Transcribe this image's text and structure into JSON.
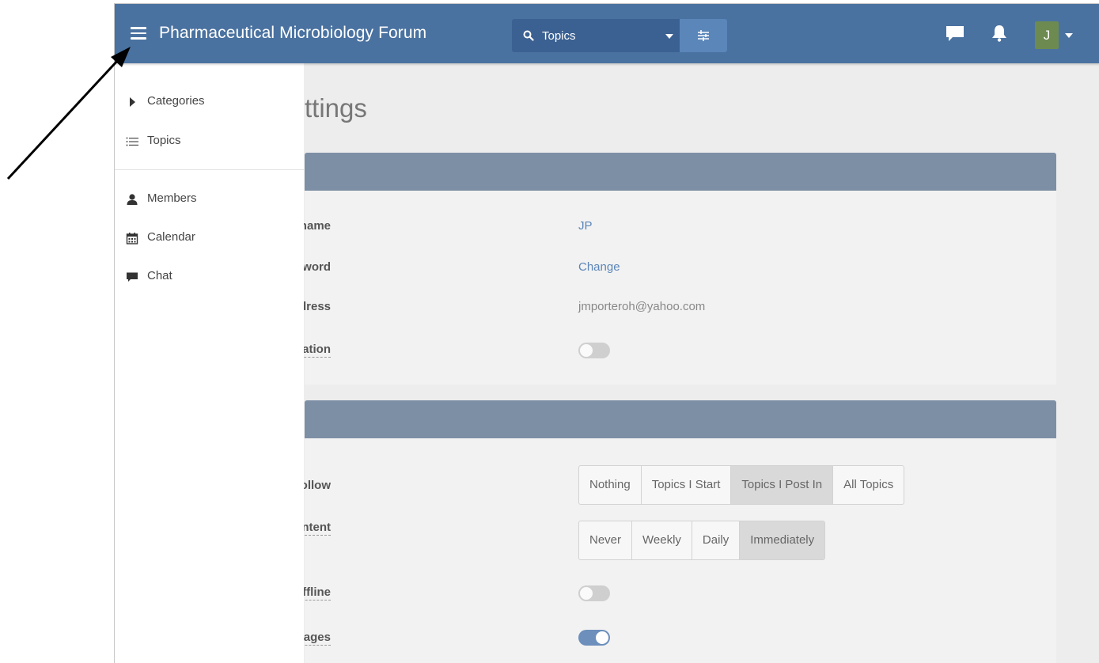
{
  "header": {
    "title": "Pharmaceutical Microbiology Forum",
    "search_scope": "Topics",
    "avatar_letter": "J",
    "color": "#4a72a0"
  },
  "page": {
    "title": "ttings"
  },
  "drawer": {
    "items": [
      {
        "label": "Categories",
        "icon": "caret-right-icon"
      },
      {
        "label": "Topics",
        "icon": "list-icon"
      },
      {
        "label": "Members",
        "icon": "user-icon"
      },
      {
        "label": "Calendar",
        "icon": "calendar-icon"
      },
      {
        "label": "Chat",
        "icon": "chat-bubble-icon"
      }
    ]
  },
  "account": {
    "username_label": "Username",
    "username_value": "JP",
    "password_label": "Password",
    "password_value": "Change",
    "email_label": "ail Address",
    "email_value": "jmporteroh@yahoo.com",
    "twofa_label": "hentication",
    "twofa_on": false
  },
  "preferences": {
    "follow_label": "ically Follow",
    "follow_options": [
      "Nothing",
      "Topics I Start",
      "Topics I Post In",
      "All Topics"
    ],
    "follow_selected": "Topics I Post In",
    "content_label": "ed Content",
    "content_options": [
      "Never",
      "Weekly",
      "Daily",
      "Immediately"
    ],
    "content_selected": "Immediately",
    "offline_label": "Offline",
    "offline_on": false,
    "messages_label": "Messages",
    "messages_on": true
  }
}
